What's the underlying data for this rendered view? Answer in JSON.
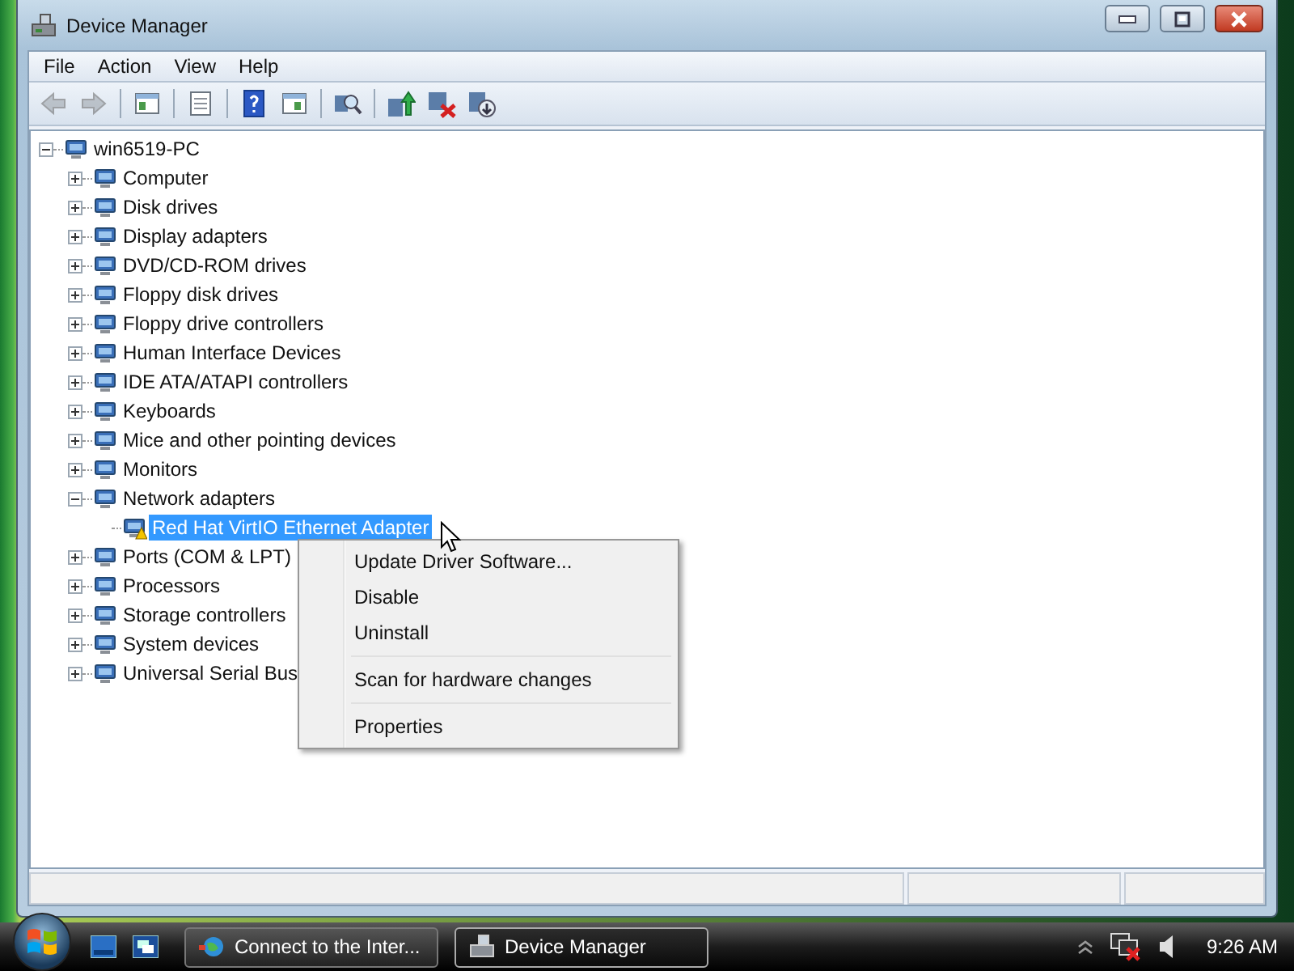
{
  "window": {
    "title": "Device Manager"
  },
  "menu": [
    "File",
    "Action",
    "View",
    "Help"
  ],
  "toolbar": [
    {
      "kind": "back",
      "disabled": true
    },
    {
      "kind": "forward",
      "disabled": true
    },
    {
      "kind": "panel"
    },
    {
      "kind": "document"
    },
    {
      "kind": "help"
    },
    {
      "kind": "panel-right"
    },
    {
      "kind": "scan"
    },
    {
      "kind": "update"
    },
    {
      "kind": "uninstall"
    },
    {
      "kind": "disable"
    }
  ],
  "tree": {
    "label": "win6519-PC",
    "expanded": true,
    "selected": false,
    "children": [
      {
        "label": "Computer",
        "expanded": false,
        "selected": false
      },
      {
        "label": "Disk drives",
        "expanded": false,
        "selected": false
      },
      {
        "label": "Display adapters",
        "expanded": false,
        "selected": false
      },
      {
        "label": "DVD/CD-ROM drives",
        "expanded": false,
        "selected": false
      },
      {
        "label": "Floppy disk drives",
        "expanded": false,
        "selected": false
      },
      {
        "label": "Floppy drive controllers",
        "expanded": false,
        "selected": false
      },
      {
        "label": "Human Interface Devices",
        "expanded": false,
        "selected": false
      },
      {
        "label": "IDE ATA/ATAPI controllers",
        "expanded": false,
        "selected": false
      },
      {
        "label": "Keyboards",
        "expanded": false,
        "selected": false
      },
      {
        "label": "Mice and other pointing devices",
        "expanded": false,
        "selected": false
      },
      {
        "label": "Monitors",
        "expanded": false,
        "selected": false
      },
      {
        "label": "Network adapters",
        "expanded": true,
        "selected": false,
        "children": [
          {
            "label": "Red Hat VirtIO Ethernet Adapter",
            "selected": true,
            "warning": true
          }
        ]
      },
      {
        "label": "Ports (COM & LPT)",
        "expanded": false,
        "selected": false
      },
      {
        "label": "Processors",
        "expanded": false,
        "selected": false
      },
      {
        "label": "Storage controllers",
        "expanded": false,
        "selected": false
      },
      {
        "label": "System devices",
        "expanded": false,
        "selected": false
      },
      {
        "label": "Universal Serial Bus",
        "expanded": false,
        "selected": false
      }
    ]
  },
  "context_menu": [
    {
      "kind": "item",
      "label": "Update Driver Software..."
    },
    {
      "kind": "item",
      "label": "Disable"
    },
    {
      "kind": "item",
      "label": "Uninstall"
    },
    {
      "kind": "separator"
    },
    {
      "kind": "item",
      "label": "Scan for hardware changes"
    },
    {
      "kind": "separator"
    },
    {
      "kind": "item",
      "label": "Properties"
    }
  ],
  "taskbar": {
    "tasks": [
      {
        "label": "Connect to the Inter...",
        "selected": false
      },
      {
        "label": "Device Manager",
        "selected": true
      }
    ],
    "clock": "9:26 AM"
  }
}
